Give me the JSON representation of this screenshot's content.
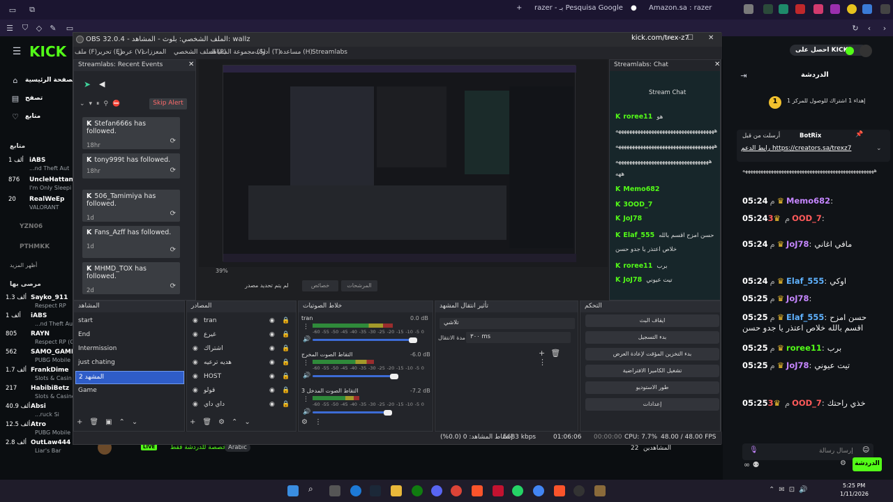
{
  "browser": {
    "tabs": [
      {
        "label": "razer - بـ Pesquisa Google"
      },
      {
        "label": "Amazon.sa : razer"
      }
    ],
    "url": "kick.com/trex-z7"
  },
  "kick_left": {
    "logo": "KICK",
    "nav": [
      {
        "label": "الصفحة الرئيسية"
      },
      {
        "label": "تصفح"
      },
      {
        "label": "متابع"
      }
    ],
    "section_following": "متابع",
    "following": [
      {
        "count": "1 ألف",
        "name": "iABS",
        "game": "...nd Theft Aut"
      },
      {
        "count": "876",
        "name": "UncleHattan",
        "game": "I'm Only Sleepi"
      },
      {
        "count": "20",
        "name": "RealWeEp",
        "game": "VALORANT"
      },
      {
        "count": "",
        "name": "YZN06",
        "game": ""
      },
      {
        "count": "",
        "name": "PTHMKK",
        "game": ""
      }
    ],
    "show_more": "أظهر المزيد",
    "section_recommended": "مرصى بها",
    "recommended": [
      {
        "count": "1.3 ألف",
        "name": "Sayko_911",
        "game": "Respect RP"
      },
      {
        "count": "1 ألف",
        "name": "iABS",
        "game": "...nd Theft Aut"
      },
      {
        "count": "805",
        "name": "RAYN",
        "game": "Respect RP (G"
      },
      {
        "count": "562",
        "name": "SAMO_GAMI",
        "game": "PUBG Mobile"
      },
      {
        "count": "1.7 ألف",
        "name": "FrankDime",
        "game": "Slots & Casin"
      },
      {
        "count": "217",
        "name": "HabibiBetz",
        "game": "Slots & Casino"
      },
      {
        "count": "40.9 ألف",
        "name": "Absi",
        "game": "...ruck Si"
      },
      {
        "count": "12.5 ألف",
        "name": "Atro",
        "game": "PUBG Mobile"
      },
      {
        "count": "2.8 ألف",
        "name": "OutLaw444",
        "game": "Liar's Bar"
      }
    ]
  },
  "obs": {
    "title": "OBS 32.0.4 - الملف الشخصي: بلوث - المشاهد: wallz",
    "menu": [
      {
        "label": "ملف (F)"
      },
      {
        "label": "تحرير (E)"
      },
      {
        "label": "عرض (V)"
      },
      {
        "label": "المعززات"
      },
      {
        "label": "الملف الشخصي (P)"
      },
      {
        "label": "مجموعة المشاهد (S)"
      },
      {
        "label": "أدوات (T)"
      },
      {
        "label": "مساعدة (H)"
      },
      {
        "label": "Streamlabs"
      }
    ],
    "recent_events": {
      "title": "Streamlabs: Recent Events",
      "skip": "Skip Alert",
      "items": [
        {
          "text": "Stefan666s has followed.",
          "time": "18hr"
        },
        {
          "text": "tony999t has followed.",
          "time": "18hr"
        },
        {
          "text": "506_Tamimiya has followed.",
          "time": "1d"
        },
        {
          "text": "Fans_Azff has followed.",
          "time": "1d"
        },
        {
          "text": "MHMD_TOX has followed.",
          "time": "2d"
        }
      ]
    },
    "preview": {
      "zoom": "39%",
      "no_source": "لم يتم تحديد مصدر",
      "properties": "خصائص",
      "filters": "المرشحات"
    },
    "streamlabs_chat": {
      "title": "Streamlabs: Chat",
      "header": "Stream Chat",
      "messages": [
        {
          "user": "roree11",
          "text": "هو"
        },
        {
          "user": "",
          "text": "ههههههههههههههههههههههههههههههههههههه"
        },
        {
          "user": "",
          "text": "ههههههههههههههههههههههههههههههههههههه"
        },
        {
          "user": "",
          "text": "ههههههههههههههههههههههههههههههههههه"
        },
        {
          "user": "",
          "text": "ههه"
        },
        {
          "user": "Memo682",
          "text": ""
        },
        {
          "user": "3OOD_7",
          "text": ""
        },
        {
          "user": "JoJ78",
          "text": ""
        },
        {
          "user": "Elaf_555",
          "text": "حسن امزح اقسم بالله"
        },
        {
          "user": "",
          "text": "خلاص اعتذر يا جدو حسن"
        },
        {
          "user": "roree11",
          "text": "برب"
        },
        {
          "user": "JoJ78",
          "text": "تيت عيوني"
        }
      ]
    },
    "scenes": {
      "title": "المشاهد",
      "items": [
        {
          "label": "start"
        },
        {
          "label": "End"
        },
        {
          "label": "Intermission"
        },
        {
          "label": "just chating"
        },
        {
          "label": "المشهد 2"
        },
        {
          "label": "Game"
        }
      ]
    },
    "sources": {
      "title": "المصادر",
      "items": [
        {
          "label": "tran"
        },
        {
          "label": "غيرع"
        },
        {
          "label": "اشتراك"
        },
        {
          "label": "هديه ترعيه"
        },
        {
          "label": "HOST"
        },
        {
          "label": "قولو"
        },
        {
          "label": "داي داي"
        }
      ]
    },
    "audio_mixer": {
      "title": "خلاط الصوتيات",
      "channels": [
        {
          "name": "tran",
          "db": "0.0 dB",
          "level": 0.72
        },
        {
          "name": "التقاط الصوت المخرج",
          "db": "-6.0 dB",
          "level": 0.55
        },
        {
          "name": "التقاط الصوت المدخل 3",
          "db": "-7.2 dB",
          "level": 0.42
        }
      ],
      "scale": [
        "-60",
        "-55",
        "-50",
        "-45",
        "-40",
        "-35",
        "-30",
        "-25",
        "-20",
        "-15",
        "-10",
        "-5",
        "0"
      ]
    },
    "transitions": {
      "title": "تأثير انتقال المشهد",
      "selected": "تلاشي",
      "duration_label": "مدة الانتقال",
      "duration": "٣٠٠ ms"
    },
    "controls": {
      "title": "التحكم",
      "buttons": [
        {
          "label": "ايقاف البث"
        },
        {
          "label": "بدء التسجيل"
        },
        {
          "label": "بدء التخزين المؤقت لإعادة العرض"
        },
        {
          "label": "تشغيل الكاميرا الافتراضية"
        },
        {
          "label": "طور الاستوديو"
        },
        {
          "label": "إعدادات"
        }
      ]
    },
    "status": {
      "dropped": "إسقاط المشاهد: 0 (0.0%)",
      "bitrate": "5683 kbps",
      "live_time": "01:06:06",
      "rec_time": "00:00:00",
      "cpu": "CPU: 7.7%",
      "fps": "48.00 / 48.00 FPS"
    }
  },
  "kick_right": {
    "subscribe": "احصل على KICKs",
    "chat_title": "الدردشة",
    "goal": "إهداء 1 اشتراك للوصول للمركز 1",
    "pinned_by": "أرسلت من قبل",
    "pinned_user": "BotRix",
    "pinned_text": "رابط الدعم https://creators.sa/trexz7",
    "messages": [
      {
        "time": "05:24",
        "user": "Memo682",
        "text": "",
        "color": "p"
      },
      {
        "time": "05:24",
        "user": "3OOD_7",
        "text": "",
        "color": "r"
      },
      {
        "time": "05:24",
        "user": "JoJ78",
        "text": "مافي اغاني",
        "color": "p"
      },
      {
        "time": "05:24",
        "user": "Elaf_555",
        "text": "اوكي",
        "color": "b"
      },
      {
        "time": "05:25",
        "user": "JoJ78",
        "text": "",
        "color": "p"
      },
      {
        "time": "05:25",
        "user": "Elaf_555",
        "text": "حسن امزح اقسم بالله خلاص اعتذر يا جدو حسن",
        "color": "b"
      },
      {
        "time": "05:25",
        "user": "roree11",
        "text": "برب",
        "color": "g"
      },
      {
        "time": "05:25",
        "user": "JoJ78",
        "text": "تيت عيوني",
        "color": "p"
      },
      {
        "time": "05:25",
        "user": "3OOD_7",
        "text": "خذي راحتك",
        "color": "r"
      }
    ],
    "input_placeholder": "إرسال رسالة",
    "send": "الدردشة"
  },
  "page_bottom": {
    "live": "LIVE",
    "category": "مخصصة للدردشة فقط",
    "language": "Arabic",
    "viewers_label": "المشاهدين",
    "viewers": "22"
  },
  "taskbar": {
    "time": "5:25 PM",
    "date": "1/11/2026"
  }
}
